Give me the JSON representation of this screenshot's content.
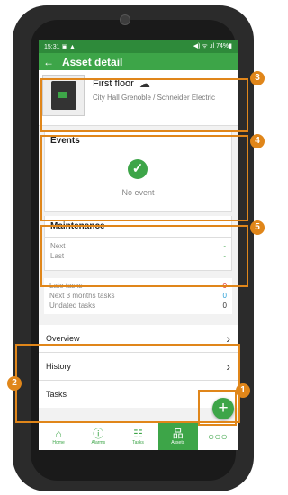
{
  "status_bar": {
    "time": "15:31",
    "left_icons": "▣ ▲",
    "right_text": "◀) ᯤ .ıl 74%▮"
  },
  "app_bar": {
    "back_icon": "back-arrow-icon",
    "title": "Asset detail"
  },
  "asset": {
    "name": "First floor",
    "cloud_icon": "cloud-icon",
    "location": "City Hall Grenoble / Schneider Electric"
  },
  "events": {
    "title": "Events",
    "empty_text": "No event"
  },
  "maintenance": {
    "title": "Maintenance",
    "rows": [
      {
        "label": "Next",
        "value": "-"
      },
      {
        "label": "Last",
        "value": "-"
      }
    ]
  },
  "tasks_summary": [
    {
      "label": "Late tasks",
      "value": "0"
    },
    {
      "label": "Next 3 months tasks",
      "value": "0"
    },
    {
      "label": "Undated tasks",
      "value": "0"
    }
  ],
  "sections": [
    {
      "label": "Overview"
    },
    {
      "label": "History"
    },
    {
      "label": "Tasks"
    }
  ],
  "fab": {
    "label": "+"
  },
  "bottom_nav": [
    {
      "label": "Home",
      "icon": "home-icon"
    },
    {
      "label": "Alarms",
      "icon": "alarm-icon"
    },
    {
      "label": "Tasks",
      "icon": "tasks-icon"
    },
    {
      "label": "Assets",
      "icon": "assets-icon"
    },
    {
      "label": "",
      "icon": "more-icon"
    }
  ],
  "annotations": {
    "b1": "1",
    "b2": "2",
    "b3": "3",
    "b4": "4",
    "b5": "5"
  },
  "colors": {
    "primary": "#3da548",
    "status_bar": "#2e8a3a",
    "annotation": "#e0861a",
    "late": "#e02020",
    "next": "#2a9fd6"
  }
}
